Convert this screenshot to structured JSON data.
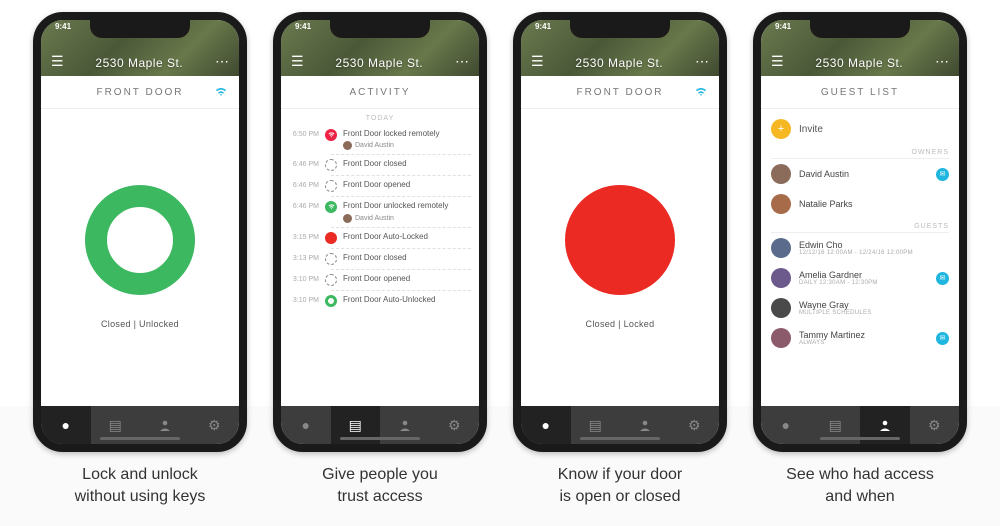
{
  "status_time": "9:41",
  "header": {
    "address": "2530 Maple St.",
    "menu_icon": "menu-icon",
    "more_icon": "more-icon"
  },
  "captions": [
    "Lock and unlock\nwithout using keys",
    "Give people you\ntrust access",
    "Know if your door\nis open or closed",
    "See who had access\nand when"
  ],
  "screens": {
    "s1": {
      "subheader": "FRONT DOOR",
      "status": "Closed | Unlocked"
    },
    "s2": {
      "subheader": "ACTIVITY",
      "today_label": "TODAY",
      "items": [
        {
          "time": "6:50 PM",
          "text": "Front Door locked remotely",
          "user": "David Austin",
          "icon": "wifi-red"
        },
        {
          "time": "6:46 PM",
          "text": "Front Door closed",
          "icon": "dash"
        },
        {
          "time": "6:46 PM",
          "text": "Front Door opened",
          "icon": "dash"
        },
        {
          "time": "6:46 PM",
          "text": "Front Door unlocked remotely",
          "user": "David Austin",
          "icon": "wifi-green"
        },
        {
          "time": "3:15 PM",
          "text": "Front Door Auto-Locked",
          "icon": "red"
        },
        {
          "time": "3:13 PM",
          "text": "Front Door closed",
          "icon": "dash"
        },
        {
          "time": "3:10 PM",
          "text": "Front Door opened",
          "icon": "dash"
        },
        {
          "time": "3:10 PM",
          "text": "Front Door Auto-Unlocked",
          "icon": "green"
        }
      ]
    },
    "s3": {
      "subheader": "FRONT DOOR",
      "status": "Closed | Locked"
    },
    "s4": {
      "subheader": "GUEST LIST",
      "invite_label": "Invite",
      "owners_label": "OWNERS",
      "guests_label": "GUESTS",
      "owners": [
        {
          "name": "David Austin",
          "color": "#8b6b5a",
          "badge": true
        },
        {
          "name": "Natalie Parks",
          "color": "#a86b4a",
          "badge": false
        }
      ],
      "guests": [
        {
          "name": "Edwin Cho",
          "sub": "12/12/16 12:00AM - 12/24/16 12:00PM",
          "color": "#5a6b8b",
          "badge": false
        },
        {
          "name": "Amelia Gardner",
          "sub": "DAILY 12:30AM - 12:30PM",
          "color": "#6b5a8b",
          "badge": true
        },
        {
          "name": "Wayne Gray",
          "sub": "MULTIPLE SCHEDULES",
          "color": "#4a4a4a",
          "badge": false
        },
        {
          "name": "Tammy Martinez",
          "sub": "ALWAYS",
          "color": "#8b5a6b",
          "badge": true
        }
      ]
    }
  },
  "tabs": {
    "lock": "lock-tab",
    "activity": "activity-tab",
    "guests": "guests-tab",
    "settings": "settings-tab"
  }
}
